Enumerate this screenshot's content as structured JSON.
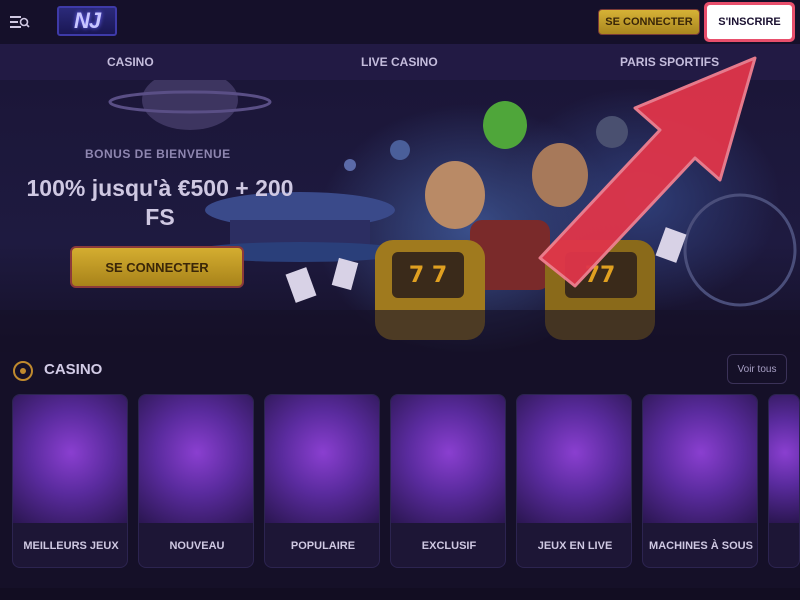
{
  "header": {
    "logo_text": "NJ",
    "login_label": "SE CONNECTER",
    "register_label": "S'INSCRIRE"
  },
  "nav": {
    "items": [
      {
        "label": "CASINO"
      },
      {
        "label": "LIVE CASINO"
      },
      {
        "label": "PARIS SPORTIFS"
      }
    ]
  },
  "hero": {
    "kicker": "BONUS DE BIENVENUE",
    "title": "100% jusqu'à €500 + 200 FS",
    "cta_label": "SE CONNECTER"
  },
  "casino_section": {
    "title": "CASINO",
    "see_all_label": "Voir tous",
    "cards": [
      {
        "label": "MEILLEURS JEUX"
      },
      {
        "label": "NOUVEAU"
      },
      {
        "label": "POPULAIRE"
      },
      {
        "label": "EXCLUSIF"
      },
      {
        "label": "JEUX EN LIVE"
      },
      {
        "label": "MACHINES À SOUS"
      },
      {
        "label": ""
      }
    ]
  },
  "colors": {
    "accent_gold": "#d4ad30",
    "accent_red": "#e84f6c",
    "background": "#120c22"
  }
}
